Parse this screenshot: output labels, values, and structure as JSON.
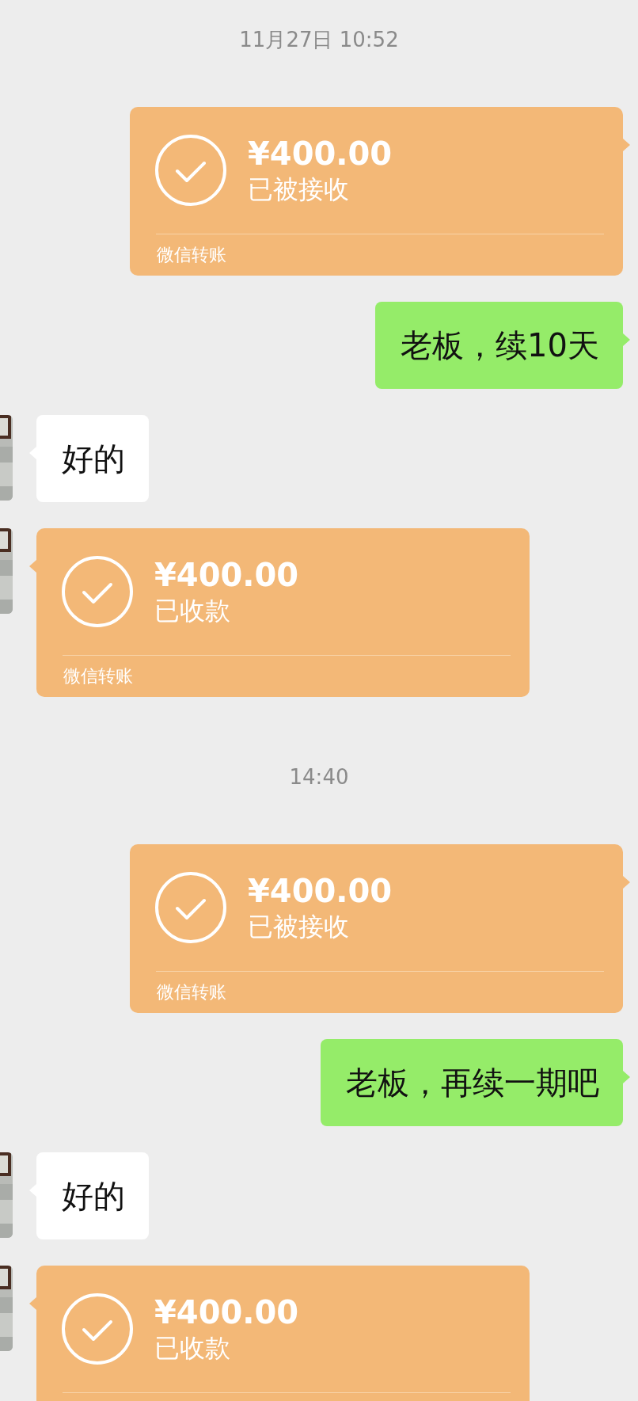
{
  "messages": [
    {
      "kind": "time",
      "text": "11月27日 10:52"
    },
    {
      "kind": "transfer",
      "outgoing": true,
      "amount": "¥400.00",
      "status": "已被接收",
      "footer": "微信转账"
    },
    {
      "kind": "text",
      "outgoing": true,
      "text": "老板，续10天"
    },
    {
      "kind": "text",
      "outgoing": false,
      "text": "好的"
    },
    {
      "kind": "transfer",
      "outgoing": false,
      "amount": "¥400.00",
      "status": "已收款",
      "footer": "微信转账"
    },
    {
      "kind": "time",
      "text": "14:40"
    },
    {
      "kind": "transfer",
      "outgoing": true,
      "amount": "¥400.00",
      "status": "已被接收",
      "footer": "微信转账"
    },
    {
      "kind": "text",
      "outgoing": true,
      "text": "老板，再续一期吧"
    },
    {
      "kind": "text",
      "outgoing": false,
      "text": "好的"
    },
    {
      "kind": "transfer",
      "outgoing": false,
      "amount": "¥400.00",
      "status": "已收款"
    }
  ]
}
